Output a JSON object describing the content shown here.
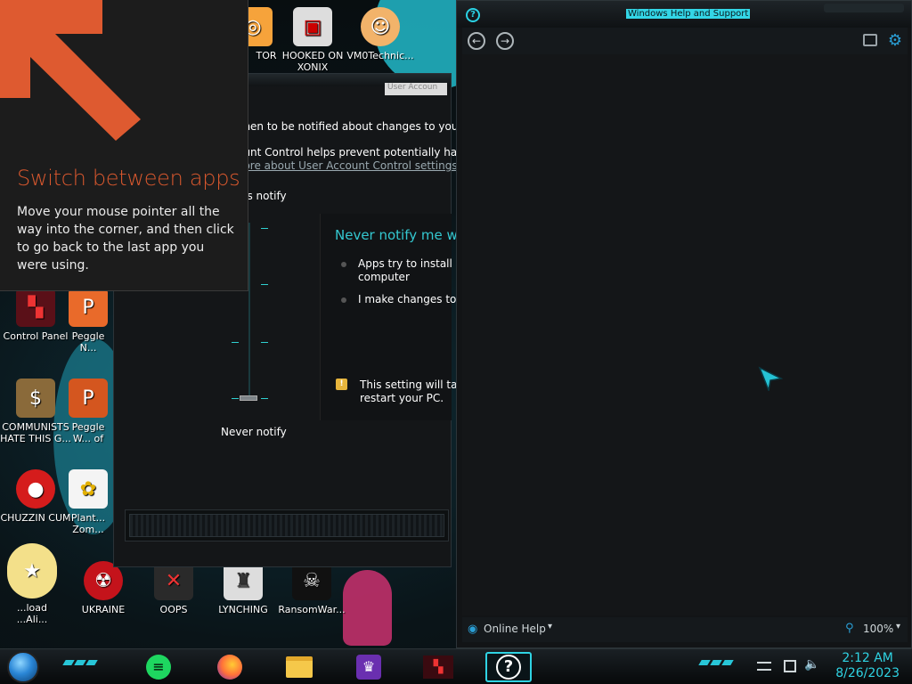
{
  "tip": {
    "title": "Switch between apps",
    "description": "Move your mouse pointer all the way into the corner, and then click to go back to the last app you were using."
  },
  "desktop_icons": [
    {
      "label": "TOR",
      "icon": "tor-icon"
    },
    {
      "label": "HOOKED ON XONIX",
      "icon": "xonix-icon"
    },
    {
      "label": "VM0Technic...",
      "icon": "vm0-icon"
    },
    {
      "label": "Control Panel",
      "icon": "control-panel-icon"
    },
    {
      "label": "Peggle N... Delu...",
      "icon": "peggle-icon"
    },
    {
      "label": "COMMUNISTS HATE THIS G...",
      "icon": "money-bag-icon"
    },
    {
      "label": "Peggle W... of Warcr...",
      "icon": "peggle-wow-icon"
    },
    {
      "label": "CHUZZIN CUM",
      "icon": "chuzzle-icon"
    },
    {
      "label": "Plant... Zom...",
      "icon": "plants-icon"
    },
    {
      "label": "...load ...Ali...",
      "icon": "star-icon"
    },
    {
      "label": "UKRAINE",
      "icon": "radiation-icon"
    },
    {
      "label": "OOPS",
      "icon": "oops-icon"
    },
    {
      "label": "LYNCHING",
      "icon": "lynching-icon"
    },
    {
      "label": "RansomWar...",
      "icon": "skull-icon"
    }
  ],
  "uac": {
    "titlebar_fragment": "User Accoun",
    "heading": "...hen to be notified about changes to your c",
    "description_line": "...unt Control helps prevent potentially harm",
    "link": "...ore about User Account Control settings",
    "slider_label_top": "...s notify",
    "slider_value_label": "Never notify",
    "slider_level": "Never notify (lowest of 4 levels)",
    "info_title": "Never notify me w",
    "bullet1_line1": "Apps try to install s",
    "bullet1_line2": "computer",
    "bullet2": "I make changes to W",
    "warning_line1": "This setting will tak",
    "warning_line2": "restart your PC."
  },
  "help": {
    "title": "Windows Help and Support",
    "online_help": "Online Help",
    "zoom": "100%"
  },
  "taskbar": {
    "time": "2:12 AM",
    "date": "8/26/2023"
  },
  "colors": {
    "accent_cyan": "#2fd3e3",
    "tip_title": "#d9582e",
    "tip_bg": "#1c1c1c"
  }
}
